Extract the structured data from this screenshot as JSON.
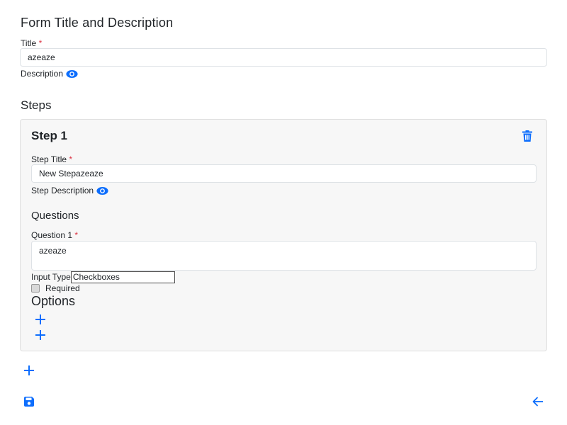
{
  "form": {
    "heading": "Form Title and Description",
    "title_label": "Title",
    "required_mark": "*",
    "title_value": "azeaze",
    "description_label": "Description"
  },
  "steps": {
    "heading": "Steps",
    "items": [
      {
        "heading": "Step 1",
        "title_label": "Step Title",
        "title_value": "New Stepazeaze",
        "description_label": "Step Description",
        "questions_heading": "Questions",
        "questions": [
          {
            "label": "Question 1",
            "value": "azeaze",
            "input_type_label": "Input Type",
            "input_type_value": "Checkboxes",
            "required_label": "Required",
            "options_heading": "Options"
          }
        ]
      }
    ]
  },
  "colors": {
    "accent": "#0d6efd",
    "required": "#dc3545"
  },
  "icons": {
    "description_toggle": "eye-icon",
    "delete_step": "trash-icon",
    "add": "plus-icon",
    "save": "floppy-disk-icon",
    "back": "arrow-left-icon"
  }
}
